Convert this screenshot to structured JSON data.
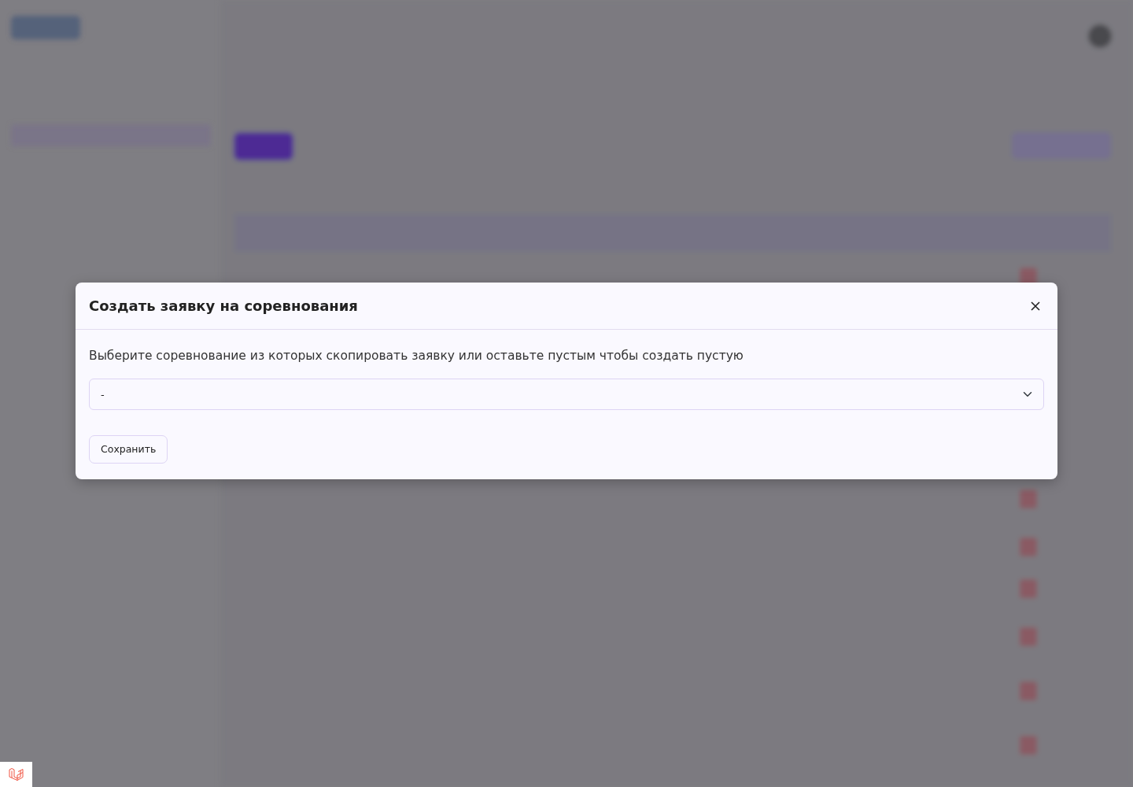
{
  "modal": {
    "title": "Создать заявку на соревнования",
    "message": "Выберите соревнование из которых скопировать заявку или оставьте пустым чтобы создать пустую",
    "select": {
      "value": "-"
    },
    "buttons": [
      {
        "label": "Сохранить"
      }
    ]
  }
}
